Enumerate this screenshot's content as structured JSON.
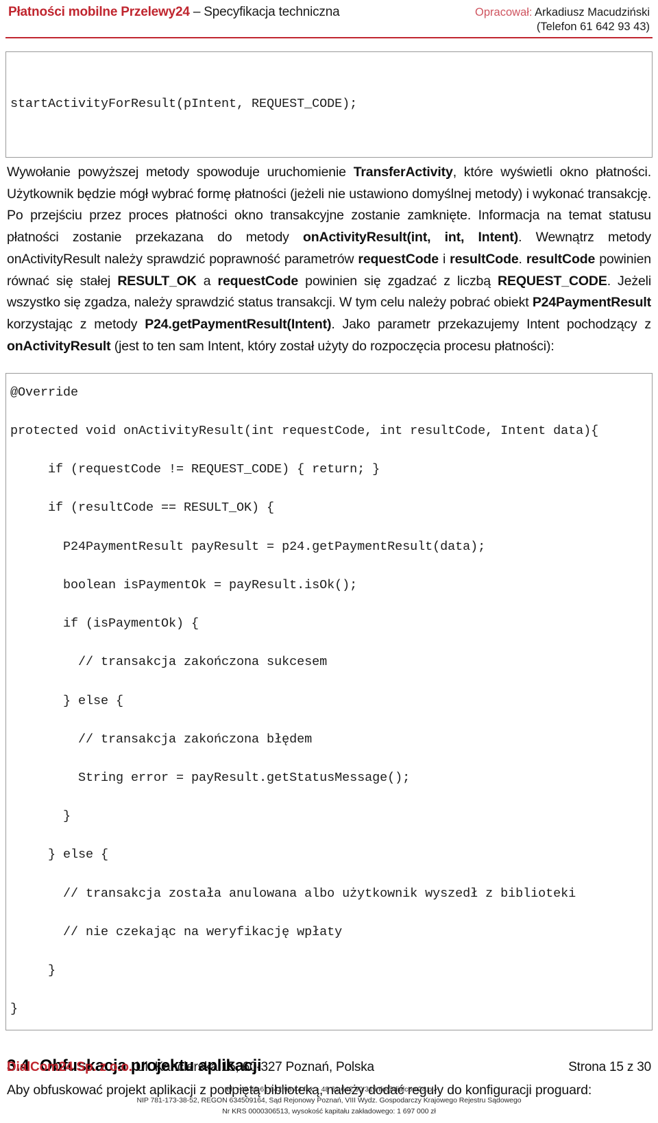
{
  "header": {
    "brand": "Płatności mobilne Przelewy24",
    "subtitle": " – Specyfikacja techniczna",
    "author_label": "Opracował:",
    "author_name": " Arkadiusz Macudziński",
    "phone": "(Telefon 61 642 93 43)",
    "accent_color": "#c0262f",
    "label_color": "#cf5560"
  },
  "code_top": {
    "line": "startActivityForResult(pIntent, REQUEST_CODE);"
  },
  "paragraph": {
    "p1_a": "Wywołanie powyższej metody spowoduje uruchomienie ",
    "p1_b1": "TransferActivity",
    "p1_b": ", które wyświetli okno płatności. Użytkownik będzie mógł wybrać formę płatności (jeżeli nie ustawiono domyślnej metody) i wykonać transakcję. Po przejściu przez proces płatności okno transakcyjne zostanie zamknięte. Informacja na temat statusu płatności zostanie przekazana do metody ",
    "p1_b2": "onActivityResult(int, int, Intent)",
    "p1_c": ". Wewnątrz metody onActivityResult należy sprawdzić poprawność parametrów ",
    "p1_b3": "requestCode",
    "p1_d": " i ",
    "p1_b4": "resultCode",
    "p1_e": ". ",
    "p1_b5": "resultCode",
    "p1_f": " powinien równać się stałej ",
    "p1_b6": "RESULT_OK",
    "p1_g": " a ",
    "p1_b7": "requestCode",
    "p1_h": " powinien się zgadzać z liczbą ",
    "p1_b8": "REQUEST_CODE",
    "p1_i": ". Jeżeli wszystko się zgadza, należy sprawdzić status transakcji. W tym celu należy pobrać obiekt ",
    "p1_b9": "P24PaymentResult",
    "p1_j": " korzystając z metody ",
    "p1_b10": "P24.getPaymentResult(Intent)",
    "p1_k": ". Jako parametr przekazujemy Intent pochodzący z ",
    "p1_b11": "onActivityResult",
    "p1_l": " (jest to ten sam Intent, który został użyty do rozpoczęcia procesu płatności):"
  },
  "code_main": {
    "lines": [
      "@Override",
      "",
      "protected void onActivityResult(int requestCode, int resultCode, Intent data){",
      "",
      "     if (requestCode != REQUEST_CODE) { return; }",
      "",
      "     if (resultCode == RESULT_OK) {",
      "",
      "       P24PaymentResult payResult = p24.getPaymentResult(data);",
      "",
      "       boolean isPaymentOk = payResult.isOk();",
      "",
      "       if (isPaymentOk) {",
      "",
      "         // transakcja zakończona sukcesem",
      "",
      "       } else {",
      "",
      "         // transakcja zakończona błędem",
      "",
      "         String error = payResult.getStatusMessage();",
      "",
      "       }",
      "",
      "     } else {",
      "",
      "       // transakcja została anulowana albo użytkownik wyszedł z biblioteki",
      "",
      "       // nie czekając na weryfikację wpłaty",
      "",
      "     }",
      "",
      "}"
    ]
  },
  "section": {
    "number": "3.4",
    "title": "Obfuskacja projektu aplikacji",
    "body": "Aby obfuskować projekt aplikacji z podpiętą biblioteką, należy dodać reguły do konfiguracji proguard:"
  },
  "footer": {
    "company_name": "DialCom24 Sp. z o.o.",
    "company_address": " Ul. Kanclerska 15, 60-327 Poznań, Polska",
    "page_label": "Strona 15 z 30",
    "legal_line1": "tel. +48 48 61 642 93 44 fax + 48 61 642 90 31 info@dialcom24.pl",
    "legal_line2": "NIP 781-173-38-52, REGON 634509164, Sąd Rejonowy Poznań, VIII Wydz. Gospodarczy Krajowego Rejestru Sądowego",
    "legal_line3": "Nr KRS 0000306513, wysokość kapitału zakładowego: 1 697 000 zł"
  }
}
